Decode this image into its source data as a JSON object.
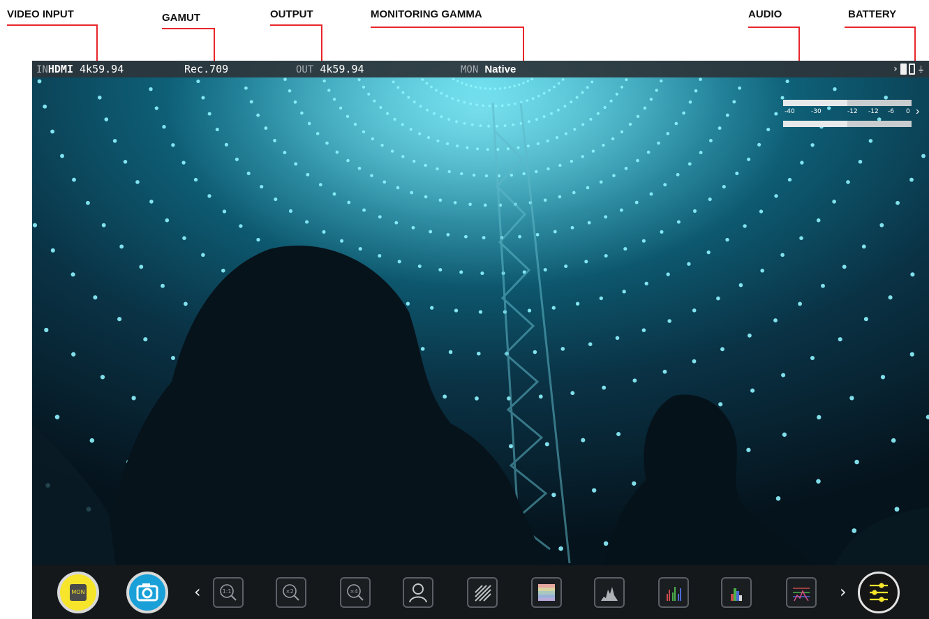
{
  "callouts": {
    "video_input": "VIDEO INPUT",
    "gamut": "GAMUT",
    "output": "OUTPUT",
    "monitoring_gamma": "MONITORING GAMMA",
    "audio": "AUDIO",
    "battery": "BATTERY"
  },
  "status_bar": {
    "input_prefix": "IN",
    "input_source": "HDMI",
    "input_format": "4k59.94",
    "gamut": "Rec.709",
    "output_prefix": "OUT",
    "output_format": "4k59.94",
    "mon_prefix": "MON",
    "mon_value": "Native",
    "battery_chevron": "›"
  },
  "audio_meter": {
    "scale": [
      "-40",
      "-30",
      "-12",
      "-12",
      "-6",
      "0"
    ],
    "levels": [
      0.5,
      0.5
    ],
    "chevron": "›"
  },
  "toolbar": {
    "mon_label": "MON",
    "left_chevron": "‹",
    "right_chevron": "›",
    "tools": [
      "zoom-1to1-icon",
      "zoom-x2-icon",
      "zoom-x4-icon",
      "focus-peaking-icon",
      "zebra-icon",
      "false-color-icon",
      "luma-waveform-icon",
      "rgb-parade-icon",
      "vectorscope-icon",
      "histogram-icon"
    ],
    "zoom_labels": [
      "1:1",
      "×2",
      "×4"
    ]
  },
  "colors": {
    "callout": "#e8262b",
    "mon_button": "#f6e52b",
    "camera_button": "#1aa0d8",
    "led": "#8ef4ff"
  }
}
